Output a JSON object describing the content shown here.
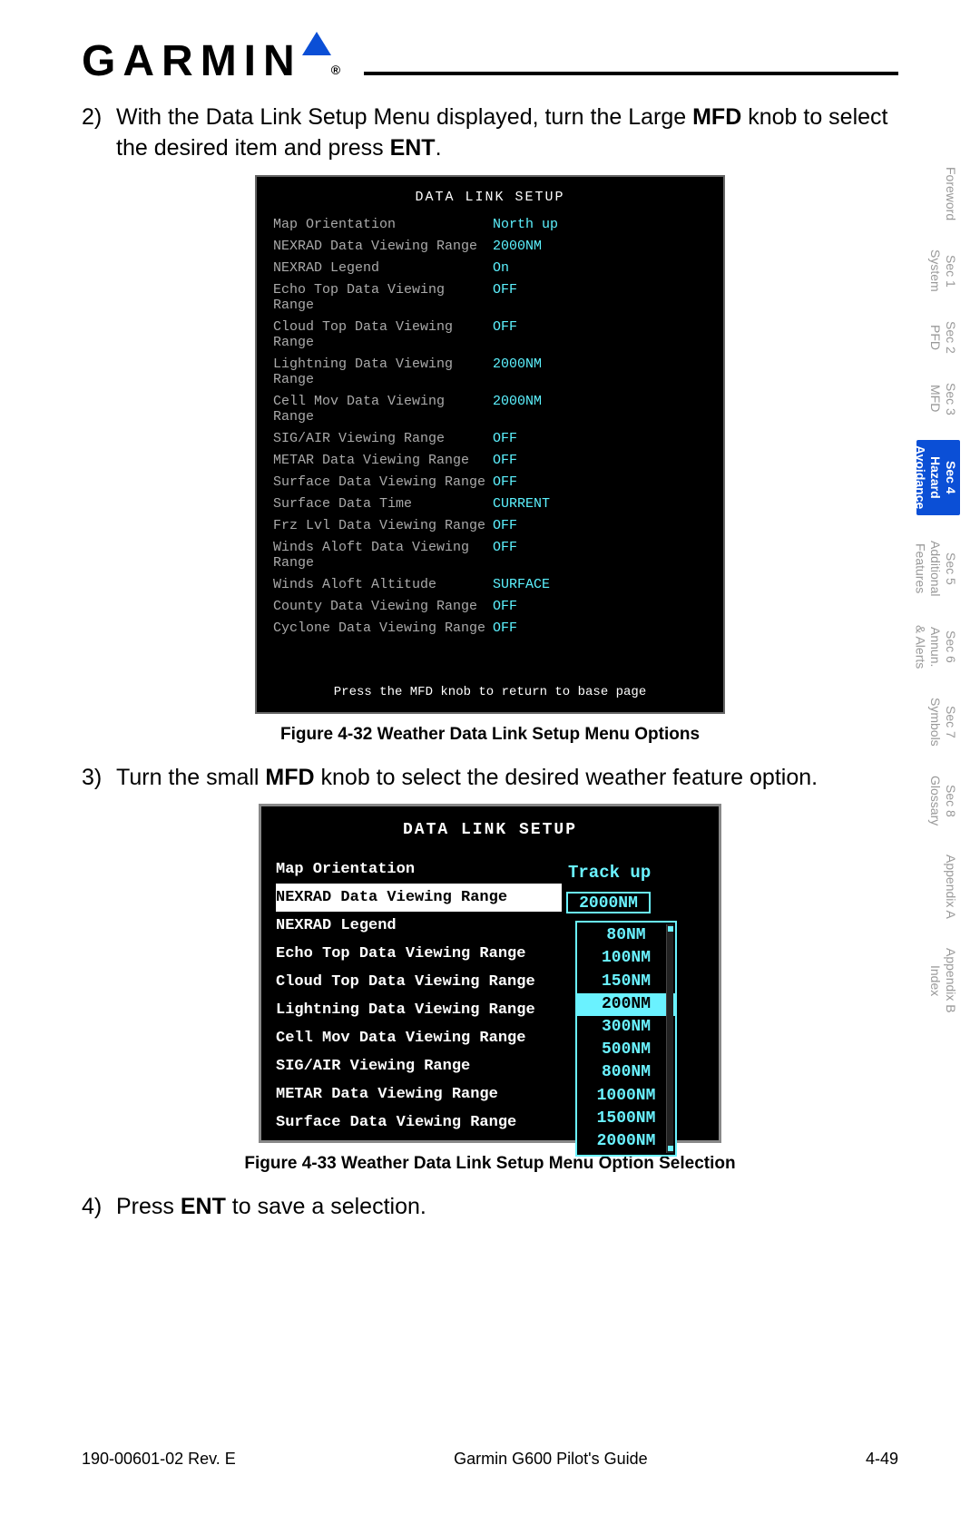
{
  "logo": "GARMIN",
  "steps": {
    "s2_num": "2)",
    "s2": "With the Data Link Setup Menu displayed, turn the Large ",
    "s2_bold": "MFD",
    "s2_b": " knob to select the desired item and press ",
    "s2_bold2": "ENT",
    "s2_c": ".",
    "s3_num": "3)",
    "s3_a": "Turn the small ",
    "s3_bold": "MFD",
    "s3_b": " knob to select the desired weather feature option.",
    "s4_num": "4)",
    "s4_a": "Press ",
    "s4_bold": "ENT",
    "s4_b": " to save a selection."
  },
  "captions": {
    "fig32": "Figure 4-32  Weather Data Link Setup Menu Options",
    "fig33": "Figure 4-33  Weather Data Link Setup Menu Option Selection"
  },
  "mfd1": {
    "title": "DATA LINK SETUP",
    "rows": [
      {
        "label": "Map Orientation",
        "val": "North up"
      },
      {
        "label": "NEXRAD Data Viewing Range",
        "val": "2000NM"
      },
      {
        "label": "NEXRAD Legend",
        "val": "On"
      },
      {
        "label": "Echo Top Data Viewing Range",
        "val": "OFF"
      },
      {
        "label": "Cloud Top Data Viewing Range",
        "val": "OFF"
      },
      {
        "label": "Lightning Data Viewing Range",
        "val": "2000NM"
      },
      {
        "label": "Cell Mov Data Viewing Range",
        "val": "2000NM"
      },
      {
        "label": "SIG/AIR Viewing Range",
        "val": "OFF"
      },
      {
        "label": "METAR Data Viewing Range",
        "val": "OFF"
      },
      {
        "label": "Surface Data Viewing Range",
        "val": "OFF"
      },
      {
        "label": "Surface Data Time",
        "val": "CURRENT"
      },
      {
        "label": "Frz Lvl Data Viewing Range",
        "val": "OFF"
      },
      {
        "label": "Winds Aloft Data Viewing Range",
        "val": "OFF"
      },
      {
        "label": "Winds Aloft Altitude",
        "val": "SURFACE"
      },
      {
        "label": "County Data Viewing Range",
        "val": "OFF"
      },
      {
        "label": "Cyclone Data Viewing Range",
        "val": "OFF"
      }
    ],
    "foot": "Press the MFD knob to return to base page"
  },
  "mfd2": {
    "title": "DATA LINK SETUP",
    "topval": "Track up",
    "sel": "2000NM",
    "rows": [
      "Map Orientation",
      "NEXRAD Data Viewing Range",
      "NEXRAD Legend",
      "Echo Top Data Viewing Range",
      "Cloud Top Data Viewing Range",
      "Lightning Data Viewing Range",
      "Cell Mov Data Viewing Range",
      "SIG/AIR Viewing Range",
      "METAR Data Viewing Range",
      "Surface Data Viewing Range"
    ],
    "selected_index": 1,
    "options": [
      "80NM",
      "100NM",
      "150NM",
      "200NM",
      "300NM",
      "500NM",
      "800NM",
      "1000NM",
      "1500NM",
      "2000NM"
    ],
    "highlight": "200NM"
  },
  "sidetabs": [
    {
      "text": "Foreword",
      "active": false
    },
    {
      "text": "Sec 1\nSystem",
      "active": false
    },
    {
      "text": "Sec 2\nPFD",
      "active": false
    },
    {
      "text": "Sec 3\nMFD",
      "active": false
    },
    {
      "text": "Sec 4\nHazard\nAvoidance",
      "active": true
    },
    {
      "text": "Sec 5\nAdditional\nFeatures",
      "active": false
    },
    {
      "text": "Sec 6\nAnnun.\n& Alerts",
      "active": false
    },
    {
      "text": "Sec 7\nSymbols",
      "active": false
    },
    {
      "text": "Sec 8\nGlossary",
      "active": false
    },
    {
      "text": "Appendix A",
      "active": false
    },
    {
      "text": "Appendix B\nIndex",
      "active": false
    }
  ],
  "footer": {
    "left": "190-00601-02  Rev. E",
    "center": "Garmin G600 Pilot's Guide",
    "right": "4-49"
  }
}
